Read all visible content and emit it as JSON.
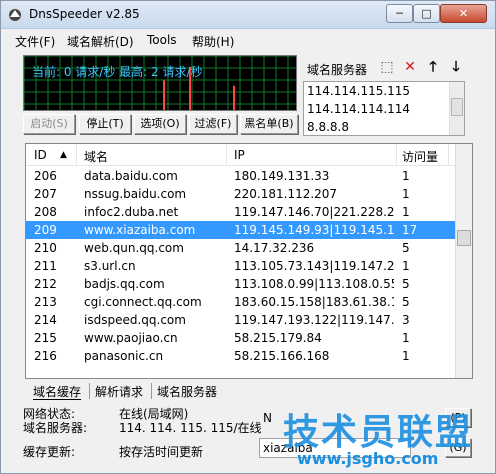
{
  "window": {
    "title": "DnsSpeeder v2.85",
    "min_label": "─",
    "max_label": "□",
    "close_label": "✕"
  },
  "menu": {
    "items": [
      "文件(F)",
      "域名解析(D)",
      "Tools",
      "帮助(H)"
    ]
  },
  "graph": {
    "text": "当前: 0 请求/秒 最高: 2 请求/秒",
    "line_color": "#ff4444",
    "grid_color": "#0f7a2a",
    "bar_levels": [
      0.55,
      0.8,
      0.45
    ]
  },
  "toolbar": {
    "start": "启动(S)",
    "stop": "停止(T)",
    "options": "选项(O)",
    "filter": "过滤(F)",
    "blacklist": "黑名单(B)"
  },
  "dns_panel": {
    "label": "域名服务器",
    "servers": [
      "114.114.115.115",
      "114.114.114.114",
      "8.8.8.8"
    ],
    "icons": [
      "new-icon",
      "delete-icon",
      "up-arrow-icon",
      "down-arrow-icon"
    ]
  },
  "table": {
    "headers": {
      "id": "ID",
      "domain": "域名",
      "ip": "IP",
      "count": "访问量"
    },
    "rows": [
      {
        "id": "206",
        "domain": "data.baidu.com",
        "ip": "180.149.131.33",
        "count": "1"
      },
      {
        "id": "207",
        "domain": "nssug.baidu.com",
        "ip": "220.181.112.207",
        "count": "1"
      },
      {
        "id": "208",
        "domain": "infoc2.duba.net",
        "ip": "119.147.146.70|221.228.2...",
        "count": "1"
      },
      {
        "id": "209",
        "domain": "www.xiazaiba.com",
        "ip": "119.145.149.93|119.145.1...",
        "count": "17"
      },
      {
        "id": "210",
        "domain": "web.qun.qq.com",
        "ip": "14.17.32.236",
        "count": "5"
      },
      {
        "id": "211",
        "domain": "s3.url.cn",
        "ip": "113.105.73.143|119.147.2...",
        "count": "1"
      },
      {
        "id": "212",
        "domain": "badjs.qq.com",
        "ip": "113.108.0.99|113.108.0.55",
        "count": "5"
      },
      {
        "id": "213",
        "domain": "cgi.connect.qq.com",
        "ip": "183.60.15.158|183.61.38.1...",
        "count": "5"
      },
      {
        "id": "214",
        "domain": "isdspeed.qq.com",
        "ip": "119.147.193.122|119.147....",
        "count": "3"
      },
      {
        "id": "215",
        "domain": "www.paojiao.cn",
        "ip": "58.215.179.84",
        "count": "1"
      },
      {
        "id": "216",
        "domain": "panasonic.cn",
        "ip": "58.215.166.168",
        "count": "1"
      }
    ],
    "selected_index": 3
  },
  "tabs": [
    "域名缓存",
    "解析请求",
    "域名服务器"
  ],
  "status": {
    "network_label": "网络状态:",
    "network_value": "在线(局域网)",
    "dns_label": "域名服务器:",
    "dns_value": "114. 114. 115. 115/在线",
    "cache_label": "缓存更新:",
    "cache_value": "按存活时间更新",
    "n_label": "N",
    "search_value": "xiazaiba",
    "p_button": "(P)",
    "g_button": "(G)"
  },
  "watermark": {
    "text": "技术员联盟",
    "url": "www.jsgho.com"
  }
}
